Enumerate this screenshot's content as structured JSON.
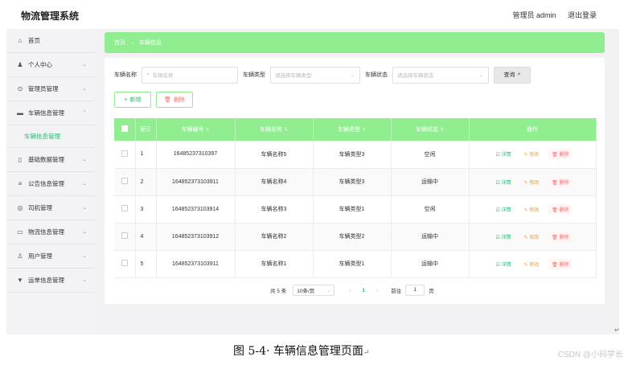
{
  "header": {
    "title": "物流管理系统",
    "user": "管理员 admin",
    "logout": "退出登录"
  },
  "sidebar": {
    "items": [
      {
        "icon": "⌂",
        "icon_name": "home-icon",
        "label": "首页",
        "chevron": ""
      },
      {
        "icon": "♟",
        "icon_name": "user-icon",
        "label": "个人中心",
        "chevron": "⌄"
      },
      {
        "icon": "⊙",
        "icon_name": "admin-icon",
        "label": "管理员管理",
        "chevron": "⌄"
      },
      {
        "icon": "▬",
        "icon_name": "vehicle-icon",
        "label": "车辆信息管理",
        "chevron": "⌃"
      }
    ],
    "sub_item": "车辆信息管理",
    "items_after": [
      {
        "icon": "▯",
        "icon_name": "database-icon",
        "label": "基础数据管理",
        "chevron": "⌄"
      },
      {
        "icon": "≡",
        "icon_name": "notice-icon",
        "label": "公告信息管理",
        "chevron": "⌄"
      },
      {
        "icon": "◎",
        "icon_name": "driver-icon",
        "label": "司机管理",
        "chevron": "⌄"
      },
      {
        "icon": "▭",
        "icon_name": "logistics-icon",
        "label": "物流信息管理",
        "chevron": "⌄"
      },
      {
        "icon": "♙",
        "icon_name": "users-icon",
        "label": "用户管理",
        "chevron": "⌄"
      },
      {
        "icon": "▼",
        "icon_name": "waybill-icon",
        "label": "运单信息管理",
        "chevron": "⌄"
      }
    ]
  },
  "breadcrumb": {
    "home": "首页",
    "arrow": "→",
    "current": "车辆信息"
  },
  "filter": {
    "name_label": "车辆名称",
    "name_placeholder": "车辆名称",
    "type_label": "车辆类型",
    "type_placeholder": "请选择车辆类型",
    "status_label": "车辆状态",
    "status_placeholder": "请选择车辆状态",
    "query_label": "查询"
  },
  "actions": {
    "add_label": "新增",
    "delete_label": "删除"
  },
  "table": {
    "headers": {
      "index": "索引",
      "code": "车辆编号",
      "name": "车辆名称",
      "type": "车辆类型",
      "status": "车辆状态",
      "ops": "操作"
    },
    "rows": [
      {
        "index": "1",
        "code": "164852373103​97",
        "name": "车辆名称5",
        "type": "车辆类型3",
        "status": "空闲"
      },
      {
        "index": "2",
        "code": "164852373103911",
        "name": "车辆名称4",
        "type": "车辆类型3",
        "status": "运输中"
      },
      {
        "index": "3",
        "code": "164852373103914",
        "name": "车辆名称3",
        "type": "车辆类型1",
        "status": "空闲"
      },
      {
        "index": "4",
        "code": "164852373103912",
        "name": "车辆名称2",
        "type": "车辆类型2",
        "status": "运输中"
      },
      {
        "index": "5",
        "code": "164852373103911",
        "name": "车辆名称1",
        "type": "车辆类型1",
        "status": "运输中"
      }
    ],
    "op_labels": {
      "detail": "☑ 详情",
      "edit": "✎ 修改",
      "remove": "🗑 删除"
    }
  },
  "pagination": {
    "total": "共 5 条",
    "page_size": "10条/页",
    "current_page": "1",
    "goto_label": "前往",
    "goto_value": "1",
    "page_suffix": "页"
  },
  "caption": {
    "text": "图 5-4· 车辆信息管理页面",
    "mark": "↵"
  },
  "watermark": "CSDN @小码学长",
  "colors": {
    "accent": "#90ee90",
    "success": "#2bb673",
    "danger": "#f56c6c",
    "warning": "#e6a23c"
  }
}
